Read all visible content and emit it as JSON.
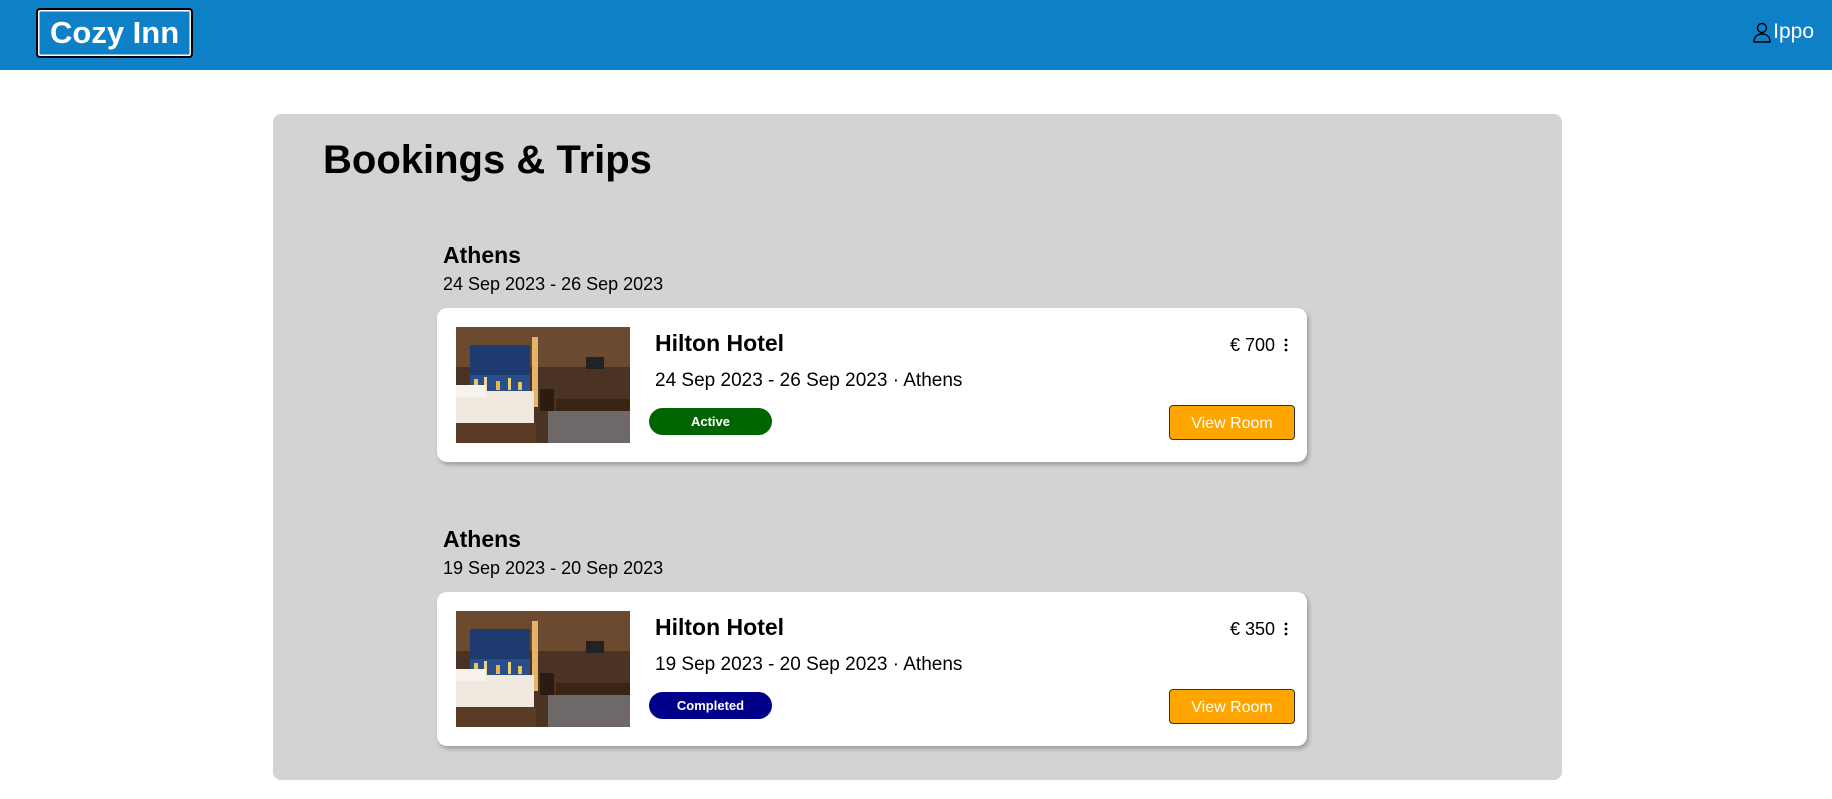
{
  "header": {
    "logo": "Cozy Inn",
    "user_name": "Ippo",
    "user_icon": "person-icon",
    "bg_color": "#0e80c8"
  },
  "main": {
    "title": "Bookings & Trips",
    "trips": [
      {
        "city": "Athens",
        "dates": "24 Sep 2023 - 26 Sep 2023",
        "booking": {
          "hotel": "Hilton Hotel",
          "meta": "24 Sep 2023 - 26 Sep 2023 · Athens",
          "price": "€ 700",
          "status": "Active",
          "status_color": "#006400",
          "button": "View Room",
          "image": "hotel-room-photo"
        }
      },
      {
        "city": "Athens",
        "dates": "19 Sep 2023 - 20 Sep 2023",
        "booking": {
          "hotel": "Hilton Hotel",
          "meta": "19 Sep 2023 - 20 Sep 2023 · Athens",
          "price": "€ 350",
          "status": "Completed",
          "status_color": "#00008b",
          "button": "View Room",
          "image": "hotel-room-photo"
        }
      }
    ]
  }
}
